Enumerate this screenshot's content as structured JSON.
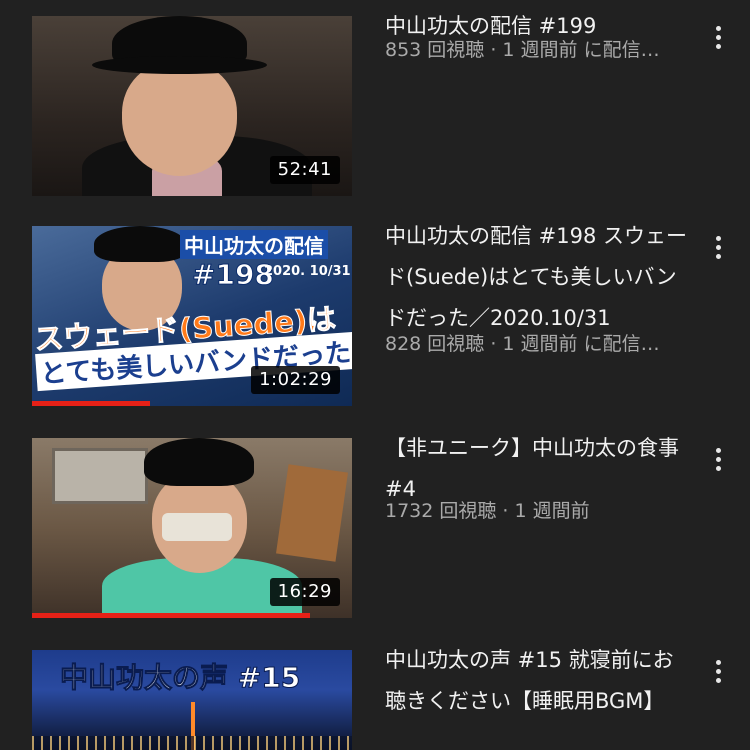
{
  "videos": [
    {
      "title": "中山功太の配信 #199",
      "meta": "853 回視聴 · 1 週間前 に配信…",
      "duration": "52:41",
      "progress": 0
    },
    {
      "title": "中山功太の配信 #198 スウェード(Suede)はとても美しいバンドだった／2020.10/31",
      "meta": "828 回視聴 · 1 週間前 に配信…",
      "duration": "1:02:29",
      "progress": 0.37,
      "thumb_text": {
        "line1": "中山功太の配信",
        "line2": "#198",
        "date": "2020. 10/31",
        "line3": "スウェード(Suede)は",
        "line4": "とても美しいバンドだった"
      }
    },
    {
      "title": "【非ユニーク】中山功太の食事 #4",
      "meta": "1732 回視聴 · 1 週間前",
      "duration": "16:29",
      "progress": 0.87
    },
    {
      "title": "中山功太の声 #15 就寝前にお聴きください【睡眠用BGM】",
      "meta": "",
      "thumb_text": {
        "line1": "中山功太の声 #15"
      }
    }
  ],
  "colors": {
    "background": "#212121",
    "progress": "#e62117",
    "meta_text": "#aaaaaa"
  },
  "icons": {
    "menu": "more-vert-icon"
  }
}
